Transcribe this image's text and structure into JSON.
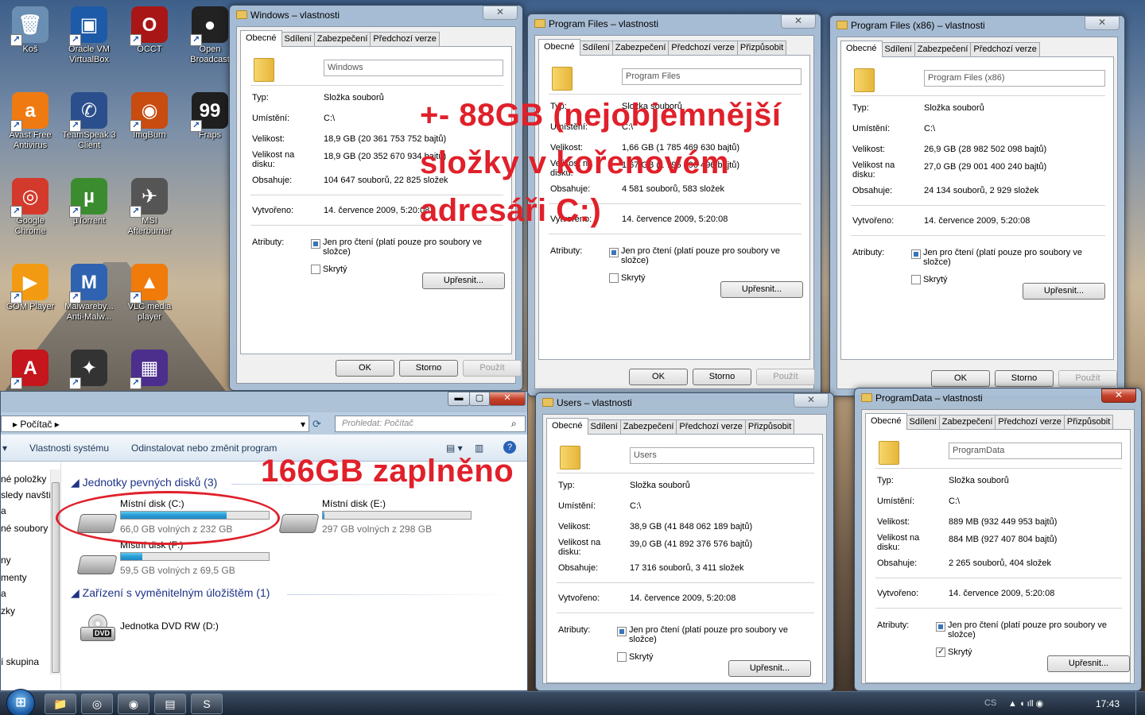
{
  "desktop_icons": [
    {
      "label": "Koš",
      "glyph": "🗑",
      "color": "#6b8fb3"
    },
    {
      "label": "Oracle VM VirtualBox",
      "glyph": "▣",
      "color": "#1d5aa8"
    },
    {
      "label": "OCCT",
      "glyph": "O",
      "color": "#a81616"
    },
    {
      "label": "Open Broadcast",
      "glyph": "●",
      "color": "#222222"
    },
    {
      "label": "Avast Free Antivirus",
      "glyph": "a",
      "color": "#f07a12"
    },
    {
      "label": "TeamSpeak 3 Client",
      "glyph": "✆",
      "color": "#2a4f8c"
    },
    {
      "label": "ImgBurn",
      "glyph": "◉",
      "color": "#c84b0f"
    },
    {
      "label": "Fraps",
      "glyph": "99",
      "color": "#1f1f1f"
    },
    {
      "label": "Google Chrome",
      "glyph": "◎",
      "color": "#d33a2c"
    },
    {
      "label": "µTorrent",
      "glyph": "µ",
      "color": "#3b8c2f"
    },
    {
      "label": "MSI Afterburner",
      "glyph": "✈",
      "color": "#555555"
    },
    {
      "label": "GOM Player",
      "glyph": "▶",
      "color": "#f29b12"
    },
    {
      "label": "Malwareby... Anti-Malw...",
      "glyph": "M",
      "color": "#2f62b0"
    },
    {
      "label": "VLC media player",
      "glyph": "▲",
      "color": "#f07a0a"
    },
    {
      "label": "",
      "glyph": "A",
      "color": "#c4161c"
    },
    {
      "label": "",
      "glyph": "✦",
      "color": "#333333"
    },
    {
      "label": "",
      "glyph": "▦",
      "color": "#4c2e8c"
    }
  ],
  "dialogs": [
    {
      "title": "Windows – vlastnosti",
      "tabs": [
        "Obecné",
        "Sdílení",
        "Zabezpečení",
        "Předchozí verze"
      ],
      "name": "Windows",
      "type_label": "Typ:",
      "type": "Složka souborů",
      "location_label": "Umístění:",
      "location": "C:\\",
      "size_label": "Velikost:",
      "size": "18,9 GB (20 361 753 752 bajtů)",
      "size_on_disk_label": "Velikost na disku:",
      "size_on_disk": "18,9 GB (20 352 670 934 bajtů)",
      "contains_label": "Obsahuje:",
      "contains": "104 647 souborů, 22 825 složek",
      "created_label": "Vytvořeno:",
      "created": "14. července 2009, 5:20:08",
      "attributes_label": "Atributy:",
      "readonly_label": "Jen pro čtení (platí pouze pro soubory ve složce)",
      "hidden_label": "Skrytý",
      "hidden_checked": false,
      "advanced_label": "Upřesnit...",
      "ok_label": "OK",
      "cancel_label": "Storno",
      "apply_label": "Použít",
      "active": true
    },
    {
      "title": "Program Files – vlastnosti",
      "tabs": [
        "Obecné",
        "Sdílení",
        "Zabezpečení",
        "Předchozí verze",
        "Přizpůsobit"
      ],
      "name": "Program Files",
      "type_label": "Typ:",
      "type": "Složka souborů",
      "location_label": "Umístění:",
      "location": "C:\\",
      "size_label": "Velikost:",
      "size": "1,66 GB (1 785 469 630 bajtů)",
      "size_on_disk_label": "Velikost na disku:",
      "size_on_disk": "1,67 GB (1 795 690 496 bajtů)",
      "contains_label": "Obsahuje:",
      "contains": "4 581 souborů, 583 složek",
      "created_label": "Vytvořeno:",
      "created": "14. července 2009, 5:20:08",
      "attributes_label": "Atributy:",
      "readonly_label": "Jen pro čtení (platí pouze pro soubory ve složce)",
      "hidden_label": "Skrytý",
      "hidden_checked": false,
      "advanced_label": "Upřesnit...",
      "ok_label": "OK",
      "cancel_label": "Storno",
      "apply_label": "Použít",
      "active": false
    },
    {
      "title": "Program Files (x86) – vlastnosti",
      "tabs": [
        "Obecné",
        "Sdílení",
        "Zabezpečení",
        "Předchozí verze"
      ],
      "name": "Program Files (x86)",
      "type_label": "Typ:",
      "type": "Složka souborů",
      "location_label": "Umístění:",
      "location": "C:\\",
      "size_label": "Velikost:",
      "size": "26,9 GB (28 982 502 098 bajtů)",
      "size_on_disk_label": "Velikost na disku:",
      "size_on_disk": "27,0 GB (29 001 400 240 bajtů)",
      "contains_label": "Obsahuje:",
      "contains": "24 134 souborů, 2 929 složek",
      "created_label": "Vytvořeno:",
      "created": "14. července 2009, 5:20:08",
      "attributes_label": "Atributy:",
      "readonly_label": "Jen pro čtení (platí pouze pro soubory ve složce)",
      "hidden_label": "Skrytý",
      "hidden_checked": false,
      "advanced_label": "Upřesnit...",
      "ok_label": "OK",
      "cancel_label": "Storno",
      "apply_label": "Použít",
      "active": false
    },
    {
      "title": "Users – vlastnosti",
      "tabs": [
        "Obecné",
        "Sdílení",
        "Zabezpečení",
        "Předchozí verze",
        "Přizpůsobit"
      ],
      "name": "Users",
      "type_label": "Typ:",
      "type": "Složka souborů",
      "location_label": "Umístění:",
      "location": "C:\\",
      "size_label": "Velikost:",
      "size": "38,9 GB (41 848 062 189 bajtů)",
      "size_on_disk_label": "Velikost na disku:",
      "size_on_disk": "39,0 GB (41 892 376 576 bajtů)",
      "contains_label": "Obsahuje:",
      "contains": "17 316 souborů, 3 411 složek",
      "created_label": "Vytvořeno:",
      "created": "14. července 2009, 5:20:08",
      "attributes_label": "Atributy:",
      "readonly_label": "Jen pro čtení (platí pouze pro soubory ve složce)",
      "hidden_label": "Skrytý",
      "hidden_checked": false,
      "advanced_label": "Upřesnit...",
      "active": false
    },
    {
      "title": "ProgramData – vlastnosti",
      "tabs": [
        "Obecné",
        "Sdílení",
        "Zabezpečení",
        "Předchozí verze",
        "Přizpůsobit"
      ],
      "name": "ProgramData",
      "type_label": "Typ:",
      "type": "Složka souborů",
      "location_label": "Umístění:",
      "location": "C:\\",
      "size_label": "Velikost:",
      "size": "889 MB (932 449 953 bajtů)",
      "size_on_disk_label": "Velikost na disku:",
      "size_on_disk": "884 MB (927 407 804 bajtů)",
      "contains_label": "Obsahuje:",
      "contains": "2 265 souborů, 404 složek",
      "created_label": "Vytvořeno:",
      "created": "14. července 2009, 5:20:08",
      "attributes_label": "Atributy:",
      "readonly_label": "Jen pro čtení (platí pouze pro soubory ve složce)",
      "hidden_label": "Skrytý",
      "hidden_checked": true,
      "advanced_label": "Upřesnit...",
      "active": true
    }
  ],
  "explorer": {
    "minimize_glyph": "▬",
    "maximize_glyph": "▢",
    "close_glyph": "✕",
    "breadcrumb": "Počítač",
    "search_placeholder": "Prohledat: Počítač",
    "commands": [
      "Vlastnosti systému",
      "Odinstalovat nebo změnit program"
    ],
    "nav_items": [
      "né položky",
      "sledy navští",
      "a",
      "né soubory",
      "ny",
      "menty",
      "a",
      "zky",
      "í skupina"
    ],
    "group_drives": "Jednotky pevných disků (3)",
    "group_removable": "Zařízení s vyměnitelným úložištěm (1)",
    "drives": [
      {
        "name": "Místní disk (C:)",
        "free": "66,0 GB volných z 232 GB",
        "used_fraction": 0.716
      },
      {
        "name": "Místní disk (E:)",
        "free": "297 GB volných z 298 GB",
        "used_fraction": 0.003
      },
      {
        "name": "Místní disk (F:)",
        "free": "59,5 GB volných z 69,5 GB",
        "used_fraction": 0.144
      }
    ],
    "dvd": {
      "name": "Jednotka DVD RW (D:)",
      "badge": "DVD"
    }
  },
  "annotations": {
    "line1": "+- 88GB (nejobjemnější",
    "line2": "složky v kořenovém",
    "line3": "adresáři C:)",
    "used": "166GB zaplněno",
    "color": "#e0202a"
  },
  "taskbar": {
    "start_glyph": "⊞",
    "pinned": [
      "📁",
      "◎",
      "◉",
      "▤",
      "S"
    ],
    "lang": "CS",
    "tray_glyphs": "▲ ◖ ıll ◉",
    "time": "17:43"
  }
}
